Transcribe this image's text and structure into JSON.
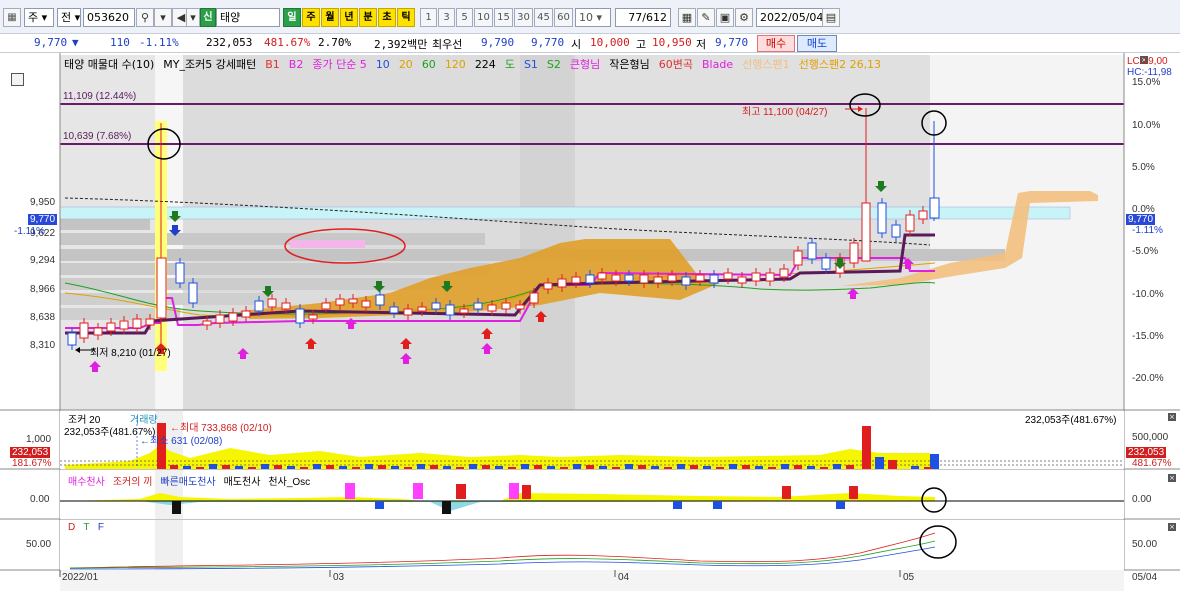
{
  "toolbar": {
    "period_select": "주",
    "scope_select": "전",
    "code": "053620",
    "search_icon": "search-icon",
    "speaker_icon": "speaker-icon",
    "badge": "신",
    "stock_name": "태양",
    "period_buttons": [
      "일",
      "주",
      "월",
      "년",
      "분",
      "초",
      "틱"
    ],
    "interval_buttons": [
      "1",
      "3",
      "5",
      "10",
      "15",
      "30",
      "45",
      "60"
    ],
    "interval_value": "10",
    "page_count": "77/612",
    "date": "2022/05/04"
  },
  "quote": {
    "price": "9,770",
    "direction": "▼",
    "change": "110",
    "change_pct": "-1.11%",
    "volume": "232,053",
    "volume_ratio": "481.67%",
    "turnover": "2.70%",
    "amount": "2,392백만",
    "bid_label": "최우선",
    "bid1": "9,790",
    "bid2": "9,770",
    "open_label": "시",
    "open": "10,000",
    "high_label": "고",
    "high": "10,950",
    "low_label": "저",
    "low": "9,770",
    "buy_button": "매수",
    "sell_button": "매도"
  },
  "legend": [
    {
      "text": "태양 매물대 수(10)",
      "color": "#000000"
    },
    {
      "text": "MY_조커5 강세패턴",
      "color": "#000000"
    },
    {
      "text": "B1",
      "color": "#e03030"
    },
    {
      "text": "B2",
      "color": "#e020e0"
    },
    {
      "text": "종가 단순 5",
      "color": "#e020e0"
    },
    {
      "text": "10",
      "color": "#2050e0"
    },
    {
      "text": "20",
      "color": "#e0a000"
    },
    {
      "text": "60",
      "color": "#20a020"
    },
    {
      "text": "120",
      "color": "#e0a000"
    },
    {
      "text": "224",
      "color": "#000000"
    },
    {
      "text": "도",
      "color": "#20a020"
    },
    {
      "text": "S1",
      "color": "#2050e0"
    },
    {
      "text": "S2",
      "color": "#20a020"
    },
    {
      "text": "큰형님",
      "color": "#e020e0"
    },
    {
      "text": "작은형님",
      "color": "#000000"
    },
    {
      "text": "60변곡",
      "color": "#e03030"
    },
    {
      "text": "Blade",
      "color": "#e020e0"
    },
    {
      "text": "선행스팬1",
      "color": "#f0c080"
    },
    {
      "text": "선행스팬2 26,13",
      "color": "#e0a000"
    }
  ],
  "right_top": {
    "lc": "LC:19,00",
    "hc": "HC:-11,98"
  },
  "price_axis": {
    "left_ticks": [
      "9,950",
      "9,622",
      "9,294",
      "8,966",
      "8,638",
      "8,310"
    ],
    "right_ticks": [
      "15.0%",
      "10.0%",
      "5.0%",
      "0.0%",
      "-5.0%",
      "-10.0%",
      "-15.0%",
      "-20.0%"
    ],
    "current_price_label": "9,770",
    "current_pct_label": "-1.11%"
  },
  "annotations": {
    "line_high": "11,109 (12.44%)",
    "line_mid": "10,639 (7.68%)",
    "high_marker": "최고 11,100 (04/27)",
    "low_marker": "최저 8,210 (01/27)"
  },
  "volume_panel": {
    "title": "조커 20",
    "subtitle": "거래량",
    "vol_label": "232,053주(481.67%)",
    "max_label": "최대 733,868 (02/10)",
    "min_label": "최소 631 (02/08)",
    "right_label": "232,053주(481.67%)",
    "left_tick": "1,000",
    "left_box1": "232,053",
    "left_box2": "181.67%",
    "right_tick": "500,000",
    "right_box1": "232,053",
    "right_box2": "481.67%"
  },
  "osc_panel": {
    "legend": [
      "매수천사",
      "조커의 끼",
      "빠른매도천사",
      "매도천사",
      "천사_Osc"
    ],
    "left_tick": "0.00",
    "right_tick": "0.00"
  },
  "dtf_panel": {
    "legend": [
      "D",
      "T",
      "F"
    ],
    "left_tick": "50.00",
    "right_tick": "50.00"
  },
  "x_axis": {
    "labels": [
      "2022/01",
      "03",
      "04",
      "05"
    ],
    "right_label": "05/04"
  },
  "colors": {
    "up": "#e11e1e",
    "down": "#1e50e1",
    "magenta": "#e020e0",
    "purple_line": "#6a1a6a",
    "cloud": "#e0a02a",
    "highlight": "#ffff99"
  }
}
